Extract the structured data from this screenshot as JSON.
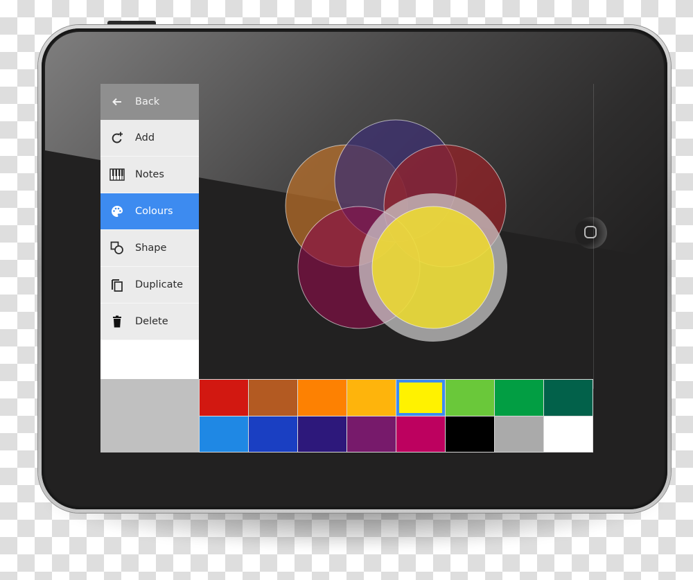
{
  "menu": {
    "back": {
      "label": "Back",
      "icon": "arrow-left-icon"
    },
    "items": [
      {
        "label": "Add",
        "icon": "add-rotate-icon",
        "active": false
      },
      {
        "label": "Notes",
        "icon": "piano-keys-icon",
        "active": false
      },
      {
        "label": "Colours",
        "icon": "palette-icon",
        "active": true
      },
      {
        "label": "Shape",
        "icon": "shape-icon",
        "active": false
      },
      {
        "label": "Duplicate",
        "icon": "duplicate-icon",
        "active": false
      },
      {
        "label": "Delete",
        "icon": "trash-icon",
        "active": false
      }
    ]
  },
  "palette": {
    "selected_index": 4,
    "colors": [
      "#d21811",
      "#b35a22",
      "#fd8102",
      "#feb40c",
      "#fff200",
      "#6ac83a",
      "#029e43",
      "#02614a",
      "#1f88e4",
      "#1a3fc2",
      "#2d187b",
      "#771a6b",
      "#bd015f",
      "#000000",
      "#aaaaaa",
      "#ffffff"
    ]
  },
  "preview": {
    "color": "#c0c0c0"
  },
  "canvas": {
    "circles": [
      {
        "name": "circle-orange",
        "color": "#b86f2a",
        "opacity": 0.92
      },
      {
        "name": "circle-purple",
        "color": "#3d2f72",
        "opacity": 0.92
      },
      {
        "name": "circle-red",
        "color": "#9b2126",
        "opacity": 0.88
      },
      {
        "name": "circle-magenta",
        "color": "#8a0e48",
        "opacity": 0.82
      },
      {
        "name": "circle-yellow-selected",
        "color": "#f5e21e",
        "opacity": 0.95,
        "selected": true
      }
    ]
  }
}
